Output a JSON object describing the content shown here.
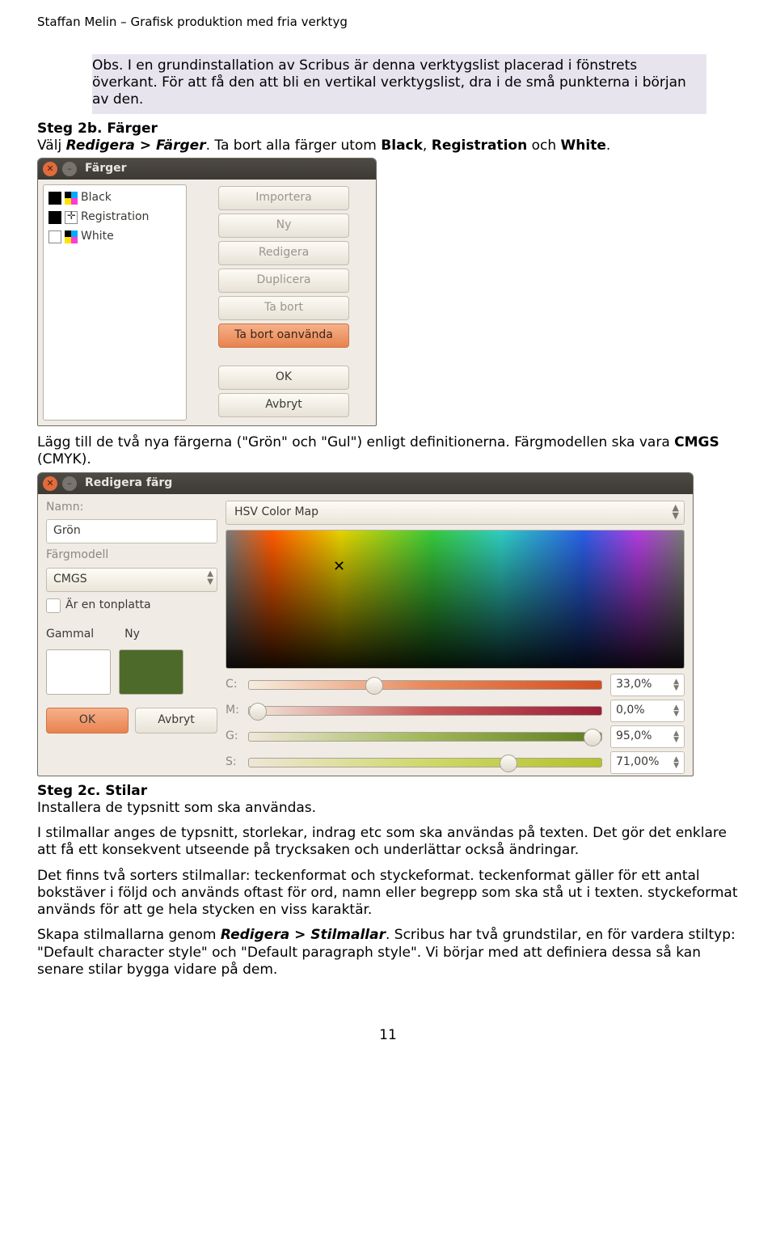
{
  "header": "Staffan Melin – Grafisk produktion med fria verktyg",
  "note": "Obs. I en grundinstallation av Scribus är denna verktygslist placerad i fönstrets överkant. För att få den att bli en vertikal verktygslist, dra i de små punkterna i början av den.",
  "step2b": {
    "title": "Steg 2b. Färger",
    "pre": "Välj ",
    "menu": "Redigera > Färger",
    "post": ". Ta bort alla färger utom ",
    "b1": "Black",
    "b2": "Registration",
    "b3": "White",
    "mid": ", ",
    "and": " och ",
    "end": "."
  },
  "dlg1": {
    "title": "Färger",
    "colors": [
      {
        "name": "Black"
      },
      {
        "name": "Registration"
      },
      {
        "name": "White"
      }
    ],
    "buttons": {
      "importera": "Importera",
      "ny": "Ny",
      "redigera": "Redigera",
      "duplicera": "Duplicera",
      "tabort": "Ta bort",
      "tabortoanv": "Ta bort oanvända",
      "ok": "OK",
      "avbryt": "Avbryt"
    }
  },
  "mid_para": {
    "pre": "Lägg till de två nya färgerna (\"Grön\" och \"Gul\") enligt definitionerna. Färgmodellen ska vara ",
    "bold": "CMGS",
    "post": " (CMYK)."
  },
  "dlg2": {
    "title": "Redigera färg",
    "namn_label": "Namn:",
    "namn_value": "Grön",
    "model_label": "Färgmodell",
    "model_value": "CMGS",
    "tonplatta": "Är en tonplatta",
    "gammal": "Gammal",
    "ny": "Ny",
    "ok": "OK",
    "avbryt": "Avbryt",
    "mapmode": "HSV Color Map",
    "ch": {
      "c": "C:",
      "m": "M:",
      "g": "G:",
      "s": "S:"
    },
    "vals": {
      "c": "33,0%",
      "m": "0,0%",
      "g": "95,0%",
      "s": "71,00%"
    }
  },
  "step2c": {
    "title": "Steg 2c. Stilar",
    "l1": "Installera de typsnitt som ska användas."
  },
  "para1": "I stilmallar anges de typsnitt, storlekar, indrag etc som ska användas på texten. Det gör det enklare att få ett konsekvent utseende på trycksaken och underlättar också ändringar.",
  "para2": "Det finns två sorters stilmallar: teckenformat och styckeformat. teckenformat gäller för ett antal bokstäver i följd och används oftast för ord, namn eller begrepp som ska stå ut i texten. styckeformat används för att ge hela stycken en viss karaktär.",
  "para3": {
    "pre": "Skapa stilmallarna genom ",
    "b": "Redigera > Stilmallar",
    "post": ". Scribus har två grundstilar, en för vardera stiltyp: \"Default character style\" och \"Default paragraph style\". Vi börjar med att definiera dessa så kan senare stilar bygga vidare på dem."
  },
  "pagenum": "11"
}
